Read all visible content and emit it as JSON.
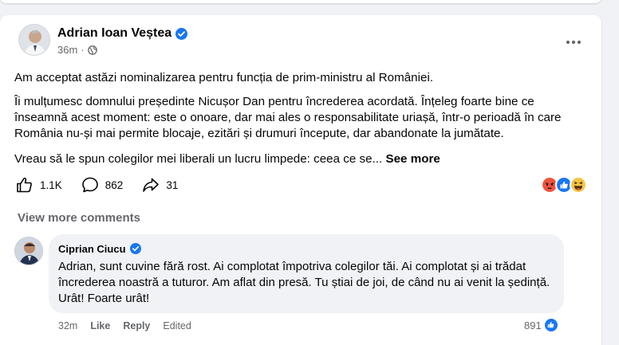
{
  "post": {
    "author": "Adrian Ioan Veștea",
    "time": "36m",
    "paragraph1": "Am acceptat astăzi nominalizarea pentru funcția de prim-ministru al României.",
    "paragraph2": "Îi mulțumesc domnului președinte Nicușor Dan pentru încrederea acordată. Înțeleg foarte bine ce înseamnă acest moment: este o onoare, dar mai ales o responsabilitate uriașă, într-o perioadă în care România nu-și mai permite blocaje, ezitări și drumuri începute, dar abandonate la jumătate.",
    "paragraph3": "Vreau să le spun colegilor mei liberali un lucru limpede: ceea ce se...",
    "see_more": "See more",
    "likes": "1.1K",
    "comments": "862",
    "shares": "31",
    "reaction_icons": [
      "angry-icon",
      "like-icon",
      "haha-icon"
    ]
  },
  "comments_section": {
    "view_more": "View more comments",
    "comment": {
      "author": "Ciprian Ciucu",
      "text": "Adrian, sunt cuvine fără rost. Ai complotat împotriva colegilor tăi. Ai complotat și ai trădat încrederea noastră a tuturor. Am aflat din presă. Tu știai de joi, de când nu ai venit la ședință. Urât! Foarte urât!",
      "time": "32m",
      "like_label": "Like",
      "reply_label": "Reply",
      "edited_label": "Edited",
      "reaction_count": "891"
    }
  },
  "colors": {
    "brand_blue": "#1877f2",
    "secondary_text": "#65676b",
    "bubble_bg": "#f0f2f5"
  }
}
